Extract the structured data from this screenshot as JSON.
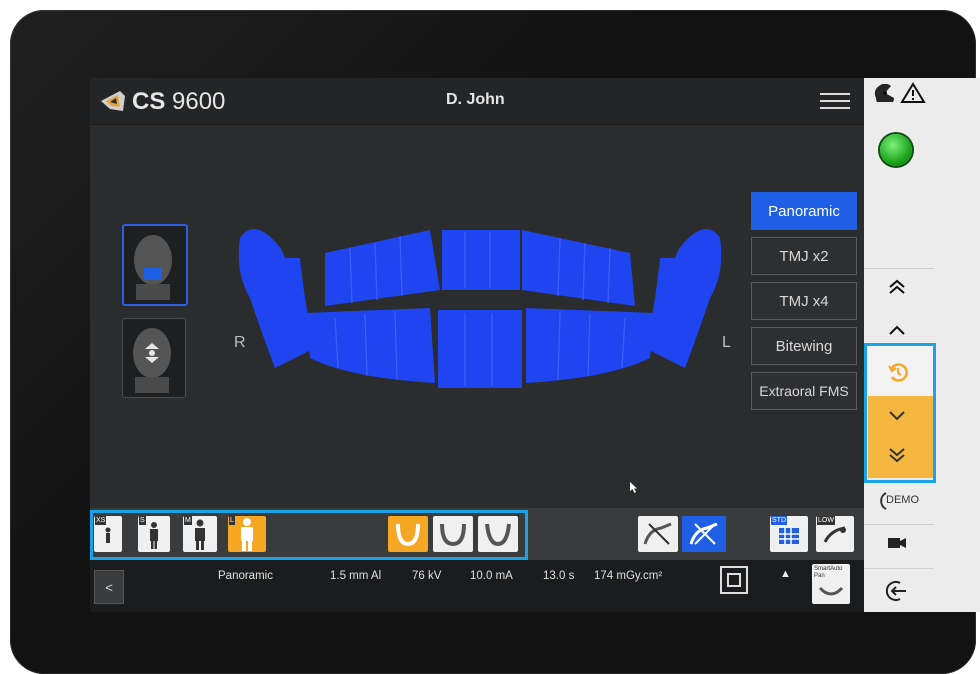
{
  "app": {
    "brand": "CS",
    "model": "9600"
  },
  "header": {
    "patient": "D. John"
  },
  "sides": {
    "right": "R",
    "left": "L"
  },
  "modes": [
    "Panoramic",
    "TMJ x2",
    "TMJ x4",
    "Bitewing",
    "Extraoral FMS"
  ],
  "active_mode": "Panoramic",
  "patient_sizes": [
    {
      "label": "XS",
      "selected": false
    },
    {
      "label": "S",
      "selected": false
    },
    {
      "label": "M",
      "selected": false
    },
    {
      "label": "L",
      "selected": true
    }
  ],
  "toggles": {
    "std": "STD",
    "low": "LOW",
    "smart": "SmartAuto Pan"
  },
  "status_bar": {
    "back": "<",
    "program": "Panoramic",
    "filter": "1.5 mm Al",
    "kv": "76 kV",
    "ma": "10.0 mA",
    "time": "13.0 s",
    "dose": "174 mGy.cm²",
    "expand": "▲"
  },
  "right_panel": {
    "demo_label": "DEMO"
  },
  "colors": {
    "accent": "#1f5fe6",
    "orange": "#f5a623",
    "highlight": "#1aa3e8",
    "ready": "#2ec12e"
  }
}
